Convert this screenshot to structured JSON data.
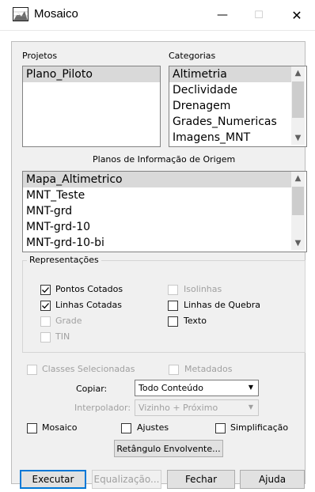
{
  "window": {
    "title": "Mosaico",
    "minimize_glyph": "—",
    "maximize_glyph": "☐",
    "close_glyph": "✕",
    "icon": "map-grid-icon"
  },
  "projects": {
    "label": "Projetos",
    "items": [
      "Plano_Piloto"
    ],
    "selected": "Plano_Piloto"
  },
  "categories": {
    "label": "Categorias",
    "items": [
      "Altimetria",
      "Declividade",
      "Drenagem",
      "Grades_Numericas",
      "Imagens_MNT"
    ],
    "selected": "Altimetria"
  },
  "source_plans": {
    "label": "Planos de Informação de Origem",
    "items": [
      "Mapa_Altimetrico",
      "MNT_Teste",
      "MNT-grd",
      "MNT-grd-10",
      "MNT-grd-10-bi"
    ],
    "selected": "Mapa_Altimetrico"
  },
  "representations": {
    "label": "Representações",
    "options": [
      {
        "label": "Pontos Cotados",
        "checked": true,
        "enabled": true
      },
      {
        "label": "Linhas Cotadas",
        "checked": true,
        "enabled": true
      },
      {
        "label": "Grade",
        "checked": false,
        "enabled": false
      },
      {
        "label": "TIN",
        "checked": false,
        "enabled": false
      },
      {
        "label": "Isolinhas",
        "checked": false,
        "enabled": false
      },
      {
        "label": "Linhas de Quebra",
        "checked": false,
        "enabled": true
      },
      {
        "label": "Texto",
        "checked": false,
        "enabled": true
      }
    ]
  },
  "selected_classes": {
    "label": "Classes Selecionadas",
    "checked": false,
    "enabled": false
  },
  "metadata": {
    "label": "Metadados",
    "checked": false,
    "enabled": false
  },
  "copy": {
    "label": "Copiar:",
    "value": "Todo Conteúdo"
  },
  "interpolator": {
    "label": "Interpolador:",
    "value": "Vizinho + Próximo"
  },
  "mosaic_option": {
    "label": "Mosaico",
    "checked": false
  },
  "adjustments": {
    "label": "Ajustes",
    "checked": false
  },
  "simplification": {
    "label": "Simplificação",
    "checked": false
  },
  "bounding_rect_button": "Retângulo Envolvente...",
  "footer": {
    "execute": "Executar",
    "equalization": "Equalização...",
    "close": "Fechar",
    "help": "Ajuda"
  },
  "colors": {
    "selection": "#d9d9d9",
    "dialog_bg": "#f0f0f0",
    "focus_border": "#0078d7"
  }
}
